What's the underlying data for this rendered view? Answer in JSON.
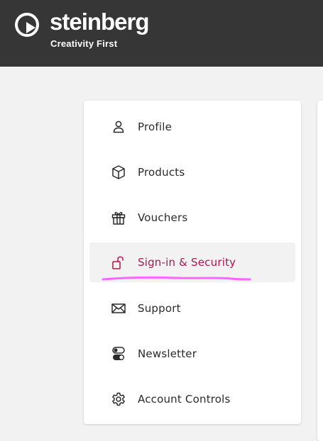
{
  "header": {
    "brand": "steinberg",
    "tagline": "Creativity First",
    "logo_icon": "play-circle-icon"
  },
  "menu": {
    "active_index": 3,
    "accent_color": "#b0154d",
    "highlight_color": "#ff66ff",
    "items": [
      {
        "label": "Profile",
        "icon": "user-icon"
      },
      {
        "label": "Products",
        "icon": "box-icon"
      },
      {
        "label": "Vouchers",
        "icon": "gift-icon"
      },
      {
        "label": "Sign-in & Security",
        "icon": "unlock-icon"
      },
      {
        "label": "Support",
        "icon": "mail-icon"
      },
      {
        "label": "Newsletter",
        "icon": "toggles-icon"
      },
      {
        "label": "Account Controls",
        "icon": "gear-icon"
      }
    ]
  }
}
